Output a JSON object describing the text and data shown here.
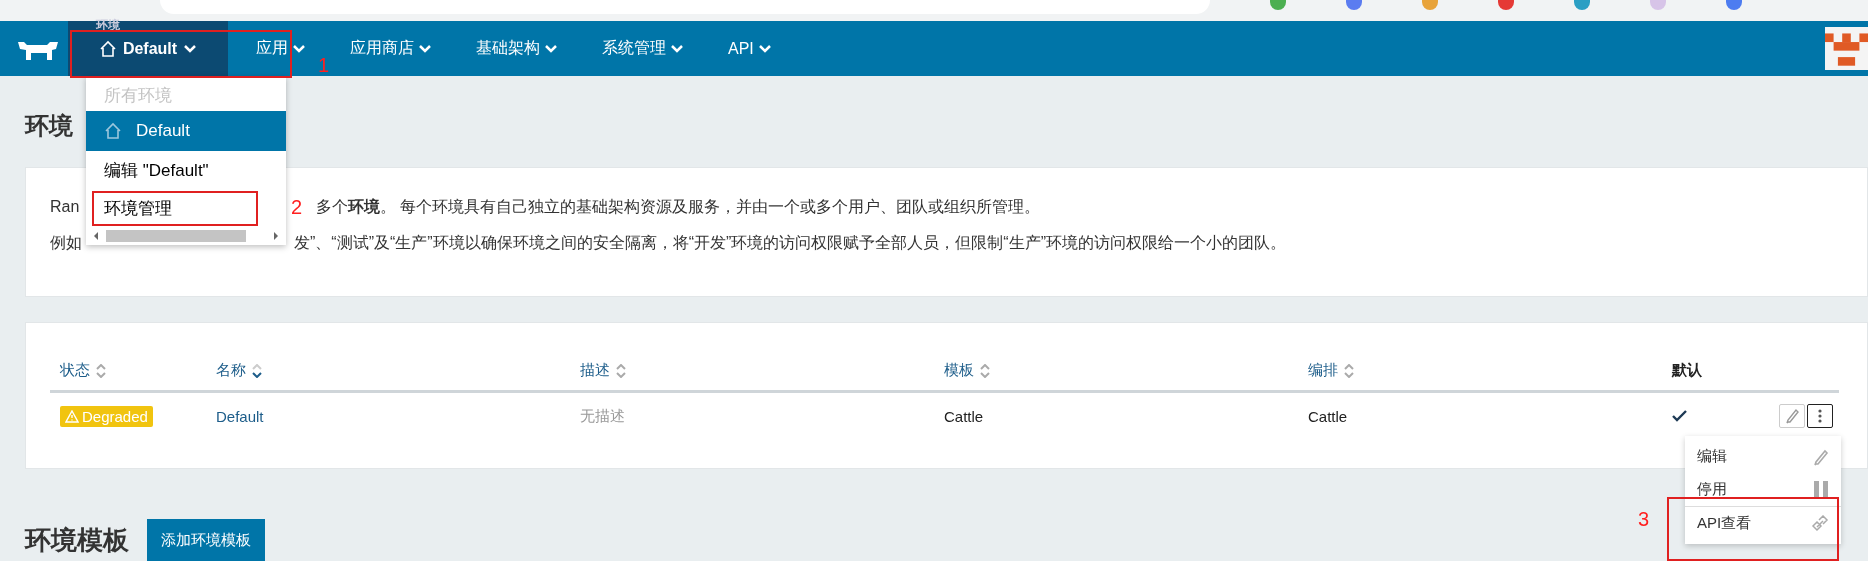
{
  "nav": {
    "env_label": "环境",
    "env_current": "Default",
    "items": [
      {
        "label": "应用"
      },
      {
        "label": "应用商店"
      },
      {
        "label": "基础架构"
      },
      {
        "label": "系统管理"
      },
      {
        "label": "API"
      }
    ]
  },
  "env_menu": {
    "header": "所有环境",
    "environments": [
      {
        "name": "Default",
        "selected": true
      }
    ],
    "actions": [
      "编辑 \"Default\"",
      "环境管理"
    ]
  },
  "page_title": "环境",
  "intro": {
    "line_1_start": "Ran",
    "line_1_rest": "多个**环境**。 每个环境具有自己独立的基础架构资源及服务，并由一个或多个用户、团队或组织所管理。",
    "line_2_start": "例如",
    "line_2_rest": "发”、“测试”及“生产”环境以确保环境之间的安全隔离，将“开发”环境的访问权限赋予全部人员，但限制“生产”环境的访问权限给一个小的团队。"
  },
  "table": {
    "columns": [
      {
        "label": "状态",
        "sortable": true,
        "sorted": false
      },
      {
        "label": "名称",
        "sortable": true,
        "sorted": true
      },
      {
        "label": "描述",
        "sortable": true,
        "sorted": false
      },
      {
        "label": "模板",
        "sortable": true,
        "sorted": false
      },
      {
        "label": "编排",
        "sortable": true,
        "sorted": false
      },
      {
        "label": "默认",
        "sortable": false
      }
    ],
    "rows": [
      {
        "status": "Degraded",
        "name": "Default",
        "description": "无描述",
        "template": "Cattle",
        "orchestration": "Cattle",
        "default": true
      }
    ]
  },
  "row_menu": [
    {
      "kind": "edit",
      "label": "编辑"
    },
    {
      "kind": "deactivate",
      "label": "停用"
    },
    {
      "kind": "api",
      "label": "API查看"
    }
  ],
  "templates_section": {
    "title": "环境模板",
    "add_button": "添加环境模板"
  },
  "annotations": [
    {
      "label": "1"
    },
    {
      "label": "2"
    },
    {
      "label": "3"
    }
  ]
}
